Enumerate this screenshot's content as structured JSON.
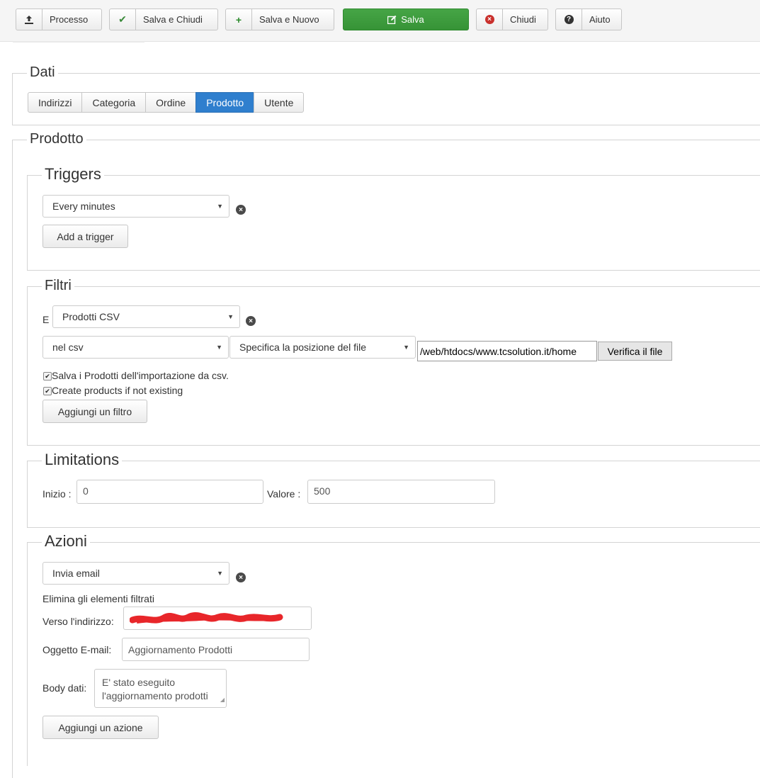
{
  "toolbar": {
    "buttons": [
      {
        "icon": "upload-icon",
        "label": "Processo"
      },
      {
        "icon": "check-icon",
        "label": "Salva e Chiudi"
      },
      {
        "icon": "plus-icon",
        "label": "Salva e Nuovo"
      },
      {
        "icon": "edit-icon",
        "label": "Salva"
      },
      {
        "icon": "close-circle-icon",
        "label": "Chiudi"
      },
      {
        "icon": "help-icon",
        "label": "Aiuto"
      }
    ]
  },
  "dati": {
    "legend": "Dati",
    "tabs": [
      "Indirizzi",
      "Categoria",
      "Ordine",
      "Prodotto",
      "Utente"
    ],
    "active_tab": "Prodotto"
  },
  "prodotto": {
    "legend": "Prodotto",
    "triggers": {
      "legend": "Triggers",
      "select_value": "Every minutes",
      "add_button": "Add a trigger"
    },
    "filtri": {
      "legend": "Filtri",
      "prefix": "E",
      "source_select": "Prodotti CSV",
      "location_select": "nel csv",
      "file_position_select": "Specifica la posizione del file",
      "file_path": "/web/htdocs/www.tcsolution.it/home",
      "verify_button": "Verifica il file",
      "checkboxes": [
        {
          "label": "Salva i Prodotti dell'importazione da csv.",
          "checked": true
        },
        {
          "label": "Create products if not existing",
          "checked": true
        }
      ],
      "add_button": "Aggiungi un filtro"
    },
    "limitations": {
      "legend": "Limitations",
      "start_label": "Inizio :",
      "start_value": "0",
      "value_label": "Valore :",
      "value_value": "500"
    },
    "azioni": {
      "legend": "Azioni",
      "action_select": "Invia email",
      "delete_text": "Elimina gli elementi filtrati",
      "to_label": "Verso l'indirizzo:",
      "subject_label": "Oggetto E-mail:",
      "subject_value": "Aggiornamento Prodotti",
      "body_label": "Body dati:",
      "body_value": "E' stato eseguito l'aggiornamento prodotti",
      "add_button": "Aggiungi un azione"
    }
  },
  "colors": {
    "primary_green": "#46a546",
    "active_tab_blue": "#2f7fce",
    "danger_red": "#c9302c",
    "redaction_red": "#e8262a"
  }
}
